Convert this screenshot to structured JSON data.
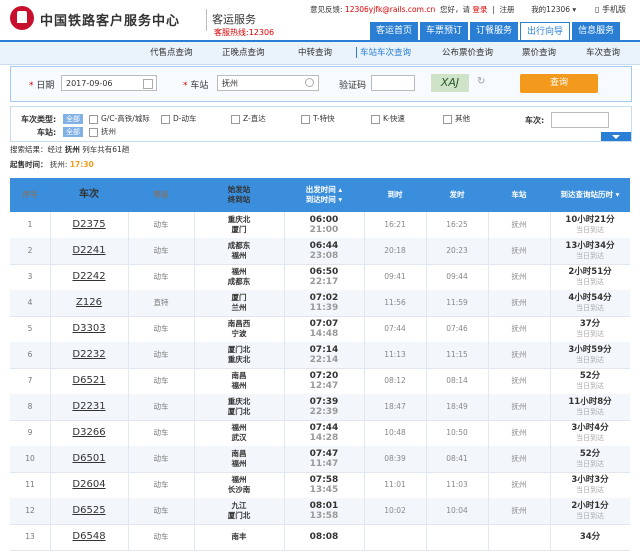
{
  "header": {
    "logo_text": "中国铁路客户服务中心",
    "sub_title": "客运服务",
    "hotline": "客服热线:12306",
    "feedback_label": "意见反馈:",
    "feedback_email": "12306yjfk@rails.com.cn",
    "greeting": "您好，请",
    "login": "登录",
    "separator": "|",
    "register": "注册",
    "my12306": "我的12306 ▾",
    "phone": "手机版"
  },
  "main_nav": [
    "客运首页",
    "车票预订",
    "订餐服务",
    "出行向导",
    "信息服务"
  ],
  "main_nav_active": 3,
  "sub_nav": [
    "代售点查询",
    "正晚点查询",
    "中转查询",
    "车站车次查询",
    "公布票价查询",
    "票价查询",
    "车次查询"
  ],
  "sub_nav_active": 3,
  "search": {
    "date_label": "日期",
    "date_value": "2017-09-06",
    "station_label": "车站",
    "station_value": "抚州",
    "captcha_label": "验证码",
    "captcha_text": "XAJ",
    "button": "查询"
  },
  "filters": {
    "type_label": "车次类型:",
    "all": "全部",
    "types": [
      "G/C-高铁/城际",
      "D-动车",
      "Z-直达",
      "T-特快",
      "K-快速",
      "其他"
    ],
    "station_label": "车站:",
    "stations": [
      "抚州"
    ],
    "train_no_label": "车次:"
  },
  "result": {
    "prefix": "搜索结果：经过",
    "station": "抚州",
    "suffix": "列车共有61趟"
  },
  "dep_time": {
    "label": "起售时间：",
    "station": "抚州:",
    "time": "17:30"
  },
  "table": {
    "headers": {
      "no": "序号",
      "train": "车次",
      "grade": "等级",
      "stations": "始发站\n终到站",
      "times": "出发时间 ▴\n到达时间 ▾",
      "arr": "到时",
      "dep": "发时",
      "station": "车站",
      "duration": "到达查询站历时 ▾"
    },
    "rows": [
      {
        "no": "1",
        "train": "D2375",
        "grade": "动车",
        "from": "重庆北",
        "to": "厦门",
        "t1": "06:00",
        "t2": "21:00",
        "arr": "16:21",
        "dep": "16:25",
        "st": "抚州",
        "d1": "10小时21分",
        "d2": "当日到达"
      },
      {
        "no": "2",
        "train": "D2241",
        "grade": "动车",
        "from": "成都东",
        "to": "福州",
        "t1": "06:44",
        "t2": "23:08",
        "arr": "20:18",
        "dep": "20:23",
        "st": "抚州",
        "d1": "13小时34分",
        "d2": "当日到达"
      },
      {
        "no": "3",
        "train": "D2242",
        "grade": "动车",
        "from": "福州",
        "to": "成都东",
        "t1": "06:50",
        "t2": "22:17",
        "arr": "09:41",
        "dep": "09:44",
        "st": "抚州",
        "d1": "2小时51分",
        "d2": "当日到达"
      },
      {
        "no": "4",
        "train": "Z126",
        "grade": "直特",
        "from": "厦门",
        "to": "兰州",
        "t1": "07:02",
        "t2": "11:39",
        "arr": "11:56",
        "dep": "11:59",
        "st": "抚州",
        "d1": "4小时54分",
        "d2": "当日到达"
      },
      {
        "no": "5",
        "train": "D3303",
        "grade": "动车",
        "from": "南昌西",
        "to": "宁波",
        "t1": "07:07",
        "t2": "14:48",
        "arr": "07:44",
        "dep": "07:46",
        "st": "抚州",
        "d1": "37分",
        "d2": "当日到达"
      },
      {
        "no": "6",
        "train": "D2232",
        "grade": "动车",
        "from": "厦门北",
        "to": "重庆北",
        "t1": "07:14",
        "t2": "22:14",
        "arr": "11:13",
        "dep": "11:15",
        "st": "抚州",
        "d1": "3小时59分",
        "d2": "当日到达"
      },
      {
        "no": "7",
        "train": "D6521",
        "grade": "动车",
        "from": "南昌",
        "to": "福州",
        "t1": "07:20",
        "t2": "12:47",
        "arr": "08:12",
        "dep": "08:14",
        "st": "抚州",
        "d1": "52分",
        "d2": "当日到达"
      },
      {
        "no": "8",
        "train": "D2231",
        "grade": "动车",
        "from": "重庆北",
        "to": "厦门北",
        "t1": "07:39",
        "t2": "22:39",
        "arr": "18:47",
        "dep": "18:49",
        "st": "抚州",
        "d1": "11小时8分",
        "d2": "当日到达"
      },
      {
        "no": "9",
        "train": "D3266",
        "grade": "动车",
        "from": "福州",
        "to": "武汉",
        "t1": "07:44",
        "t2": "14:28",
        "arr": "10:48",
        "dep": "10:50",
        "st": "抚州",
        "d1": "3小时4分",
        "d2": "当日到达"
      },
      {
        "no": "10",
        "train": "D6501",
        "grade": "动车",
        "from": "南昌",
        "to": "福州",
        "t1": "07:47",
        "t2": "11:47",
        "arr": "08:39",
        "dep": "08:41",
        "st": "抚州",
        "d1": "52分",
        "d2": "当日到达"
      },
      {
        "no": "11",
        "train": "D2604",
        "grade": "动车",
        "from": "福州",
        "to": "长沙南",
        "t1": "07:58",
        "t2": "13:45",
        "arr": "11:01",
        "dep": "11:03",
        "st": "抚州",
        "d1": "3小时3分",
        "d2": "当日到达"
      },
      {
        "no": "12",
        "train": "D6525",
        "grade": "动车",
        "from": "九江",
        "to": "厦门北",
        "t1": "08:01",
        "t2": "13:58",
        "arr": "10:02",
        "dep": "10:04",
        "st": "抚州",
        "d1": "2小时1分",
        "d2": "当日到达"
      },
      {
        "no": "13",
        "train": "D6548",
        "grade": "动车",
        "from": "南丰",
        "to": "",
        "t1": "08:08",
        "t2": "",
        "arr": "",
        "dep": "",
        "st": "",
        "d1": "34分",
        "d2": ""
      }
    ]
  }
}
